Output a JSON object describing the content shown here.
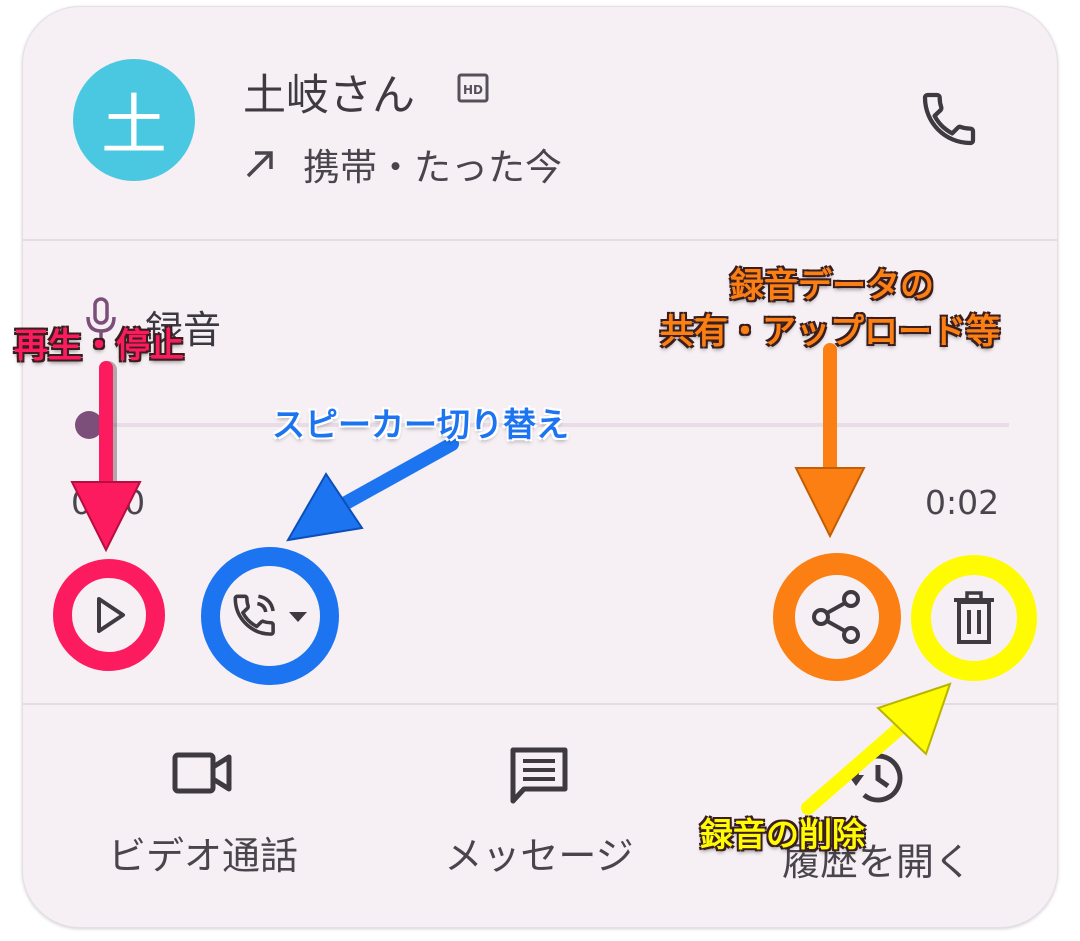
{
  "contact": {
    "avatar_letter": "土",
    "name": "土岐さん",
    "hd_badge": "HD",
    "call_direction_icon": "outgoing-arrow-icon",
    "call_detail": "携帯・たった今"
  },
  "recording": {
    "label": "録音",
    "time_start": "0:00",
    "time_end": "0:02",
    "progress": 0.0
  },
  "bottom_actions": [
    {
      "label": "ビデオ通話",
      "icon": "video-camera-icon"
    },
    {
      "label": "メッセージ",
      "icon": "message-icon"
    },
    {
      "label": "履歴を開く",
      "icon": "history-icon"
    }
  ],
  "annotations": {
    "play_stop": "再生・停止",
    "speaker_switch": "スピーカー切り替え",
    "share_line1": "録音データの",
    "share_line2": "共有・アップロード等",
    "delete": "録音の削除"
  },
  "colors": {
    "card_bg": "#f6f0f5",
    "avatar_bg": "#4ac8e2",
    "mic_accent": "#7c4f7a",
    "play_ring": "#fc1b5e",
    "speaker_ring": "#1d74f0",
    "share_ring": "#fb7f12",
    "delete_ring": "#fefb03"
  }
}
